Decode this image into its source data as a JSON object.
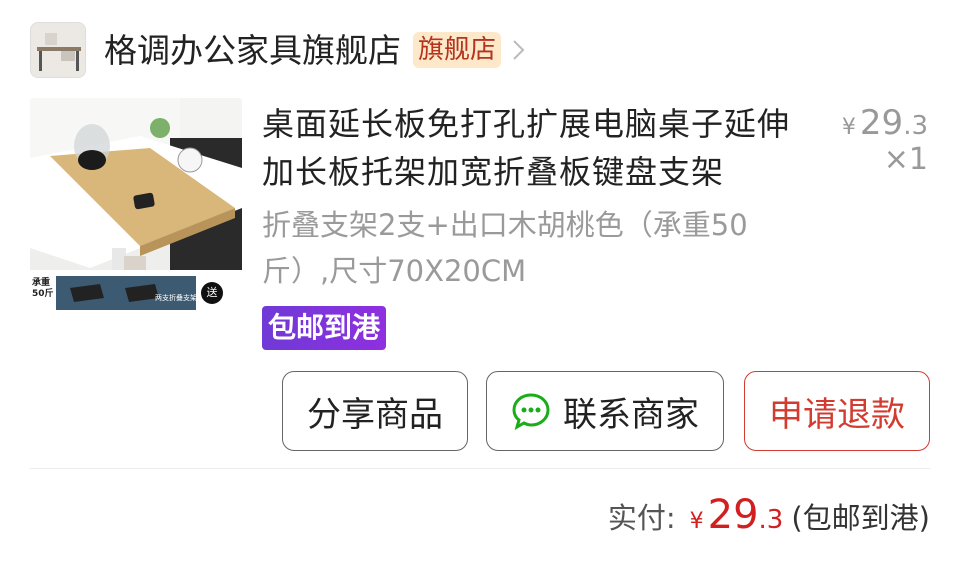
{
  "shop": {
    "name": "格调办公家具旗舰店",
    "badge": "旗舰店"
  },
  "product": {
    "title": "桌面延长板免打孔扩展电脑桌子延伸加长板托架加宽折叠板键盘支架",
    "spec": "折叠支架2支+出口木胡桃色（承重50斤）,尺寸70X20CM",
    "price_symbol": "¥",
    "price_int": "29",
    "price_dec": ".3",
    "quantity": "×1",
    "tag": "包邮到港",
    "thumbnail_texts": {
      "load": "承重50斤",
      "gift": "送",
      "caption": "两支折叠支架"
    }
  },
  "actions": {
    "share": "分享商品",
    "contact": "联系商家",
    "refund": "申请退款"
  },
  "summary": {
    "label": "实付:",
    "symbol": "¥",
    "amount_int": "29",
    "amount_dec": ".3",
    "note": "(包邮到港)"
  },
  "colors": {
    "accent_red": "#d21f1f",
    "tag_purple": "#7a35dc",
    "badge_bg": "#fde8c9",
    "wechat_green": "#1aad19"
  }
}
